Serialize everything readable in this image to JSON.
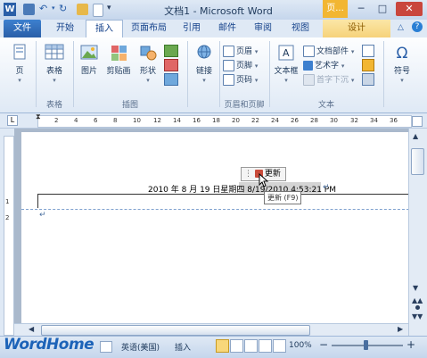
{
  "window": {
    "title": "文档1 - Microsoft Word",
    "context_tab": "页...",
    "buttons": {
      "minimize": "─",
      "maximize": "□",
      "close": "✕"
    }
  },
  "tabs": [
    "文件",
    "开始",
    "插入",
    "页面布局",
    "引用",
    "邮件",
    "审阅",
    "视图",
    "设计"
  ],
  "active_tab": "插入",
  "ribbon": {
    "pages": {
      "label": "页",
      "arrow": "▾"
    },
    "table": {
      "label": "表格",
      "group": "表格"
    },
    "illustrations": {
      "picture": "图片",
      "clipart": "剪贴画",
      "shapes": "形状",
      "group": "插图"
    },
    "links": {
      "label": "链接"
    },
    "header_footer": {
      "header": "页眉",
      "footer": "页脚",
      "page_number": "页码",
      "group": "页眉和页脚"
    },
    "text": {
      "textbox": "文本框",
      "quick_parts": "文档部件",
      "wordart": "艺术字",
      "dropcap": "首字下沉",
      "group": "文本"
    },
    "symbols": {
      "label": "符号",
      "icon": "Ω"
    }
  },
  "ruler": {
    "marks": [
      "2",
      "4",
      "6",
      "8",
      "10",
      "12",
      "14",
      "16",
      "18",
      "20",
      "22",
      "24",
      "26",
      "28",
      "30",
      "32",
      "34",
      "36"
    ]
  },
  "document": {
    "header_date_text": "2010 年 8 月 19 日星期四 8/19/2010 4:53:21 PM",
    "paragraph_mark": "↵",
    "update_popup": "更新",
    "tooltip": "更新 (F9)"
  },
  "status": {
    "watermark": "WordHome",
    "language": "英语(美国)",
    "mode": "插入",
    "zoom": "100%",
    "zoom_minus": "−",
    "zoom_plus": "+"
  },
  "colors": {
    "file_tab": "#2a5fa8",
    "context_tab": "#f2b632",
    "close_button": "#c9463d",
    "ribbon_bg": "#dfe9f5"
  }
}
